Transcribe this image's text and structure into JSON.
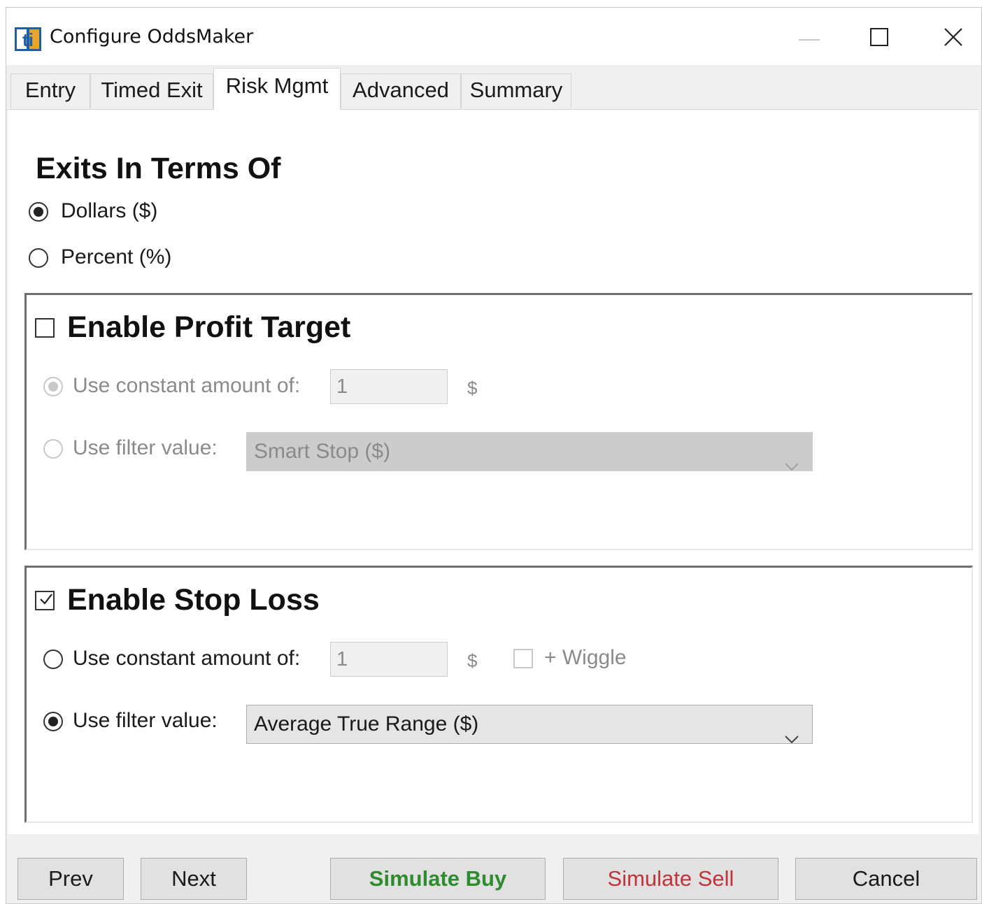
{
  "window": {
    "title": "Configure OddsMaker",
    "app_icon_text": "ti"
  },
  "tabs": [
    {
      "label": "Entry"
    },
    {
      "label": "Timed Exit"
    },
    {
      "label": "Risk Mgmt",
      "active": true
    },
    {
      "label": "Advanced"
    },
    {
      "label": "Summary"
    }
  ],
  "exits": {
    "heading": "Exits In Terms Of",
    "options": [
      {
        "label": "Dollars ($)",
        "checked": true
      },
      {
        "label": "Percent (%)",
        "checked": false
      }
    ]
  },
  "profit_target": {
    "title": "Enable Profit Target",
    "enabled": false,
    "constant_label": "Use constant amount of:",
    "constant_value": "1",
    "unit": "$",
    "filter_label": "Use filter value:",
    "filter_value": "Smart Stop ($)"
  },
  "stop_loss": {
    "title": "Enable Stop Loss",
    "enabled": true,
    "constant_label": "Use constant amount of:",
    "constant_value": "1",
    "unit": "$",
    "wiggle_label": "+ Wiggle",
    "filter_label": "Use filter value:",
    "filter_value": "Average True Range ($)"
  },
  "buttons": {
    "prev": "Prev",
    "next": "Next",
    "simulate_buy": "Simulate Buy",
    "simulate_sell": "Simulate Sell",
    "cancel": "Cancel"
  },
  "colors": {
    "buy": "#2e8b2e",
    "sell": "#c0343c",
    "app_icon": "#1f5fa8"
  }
}
